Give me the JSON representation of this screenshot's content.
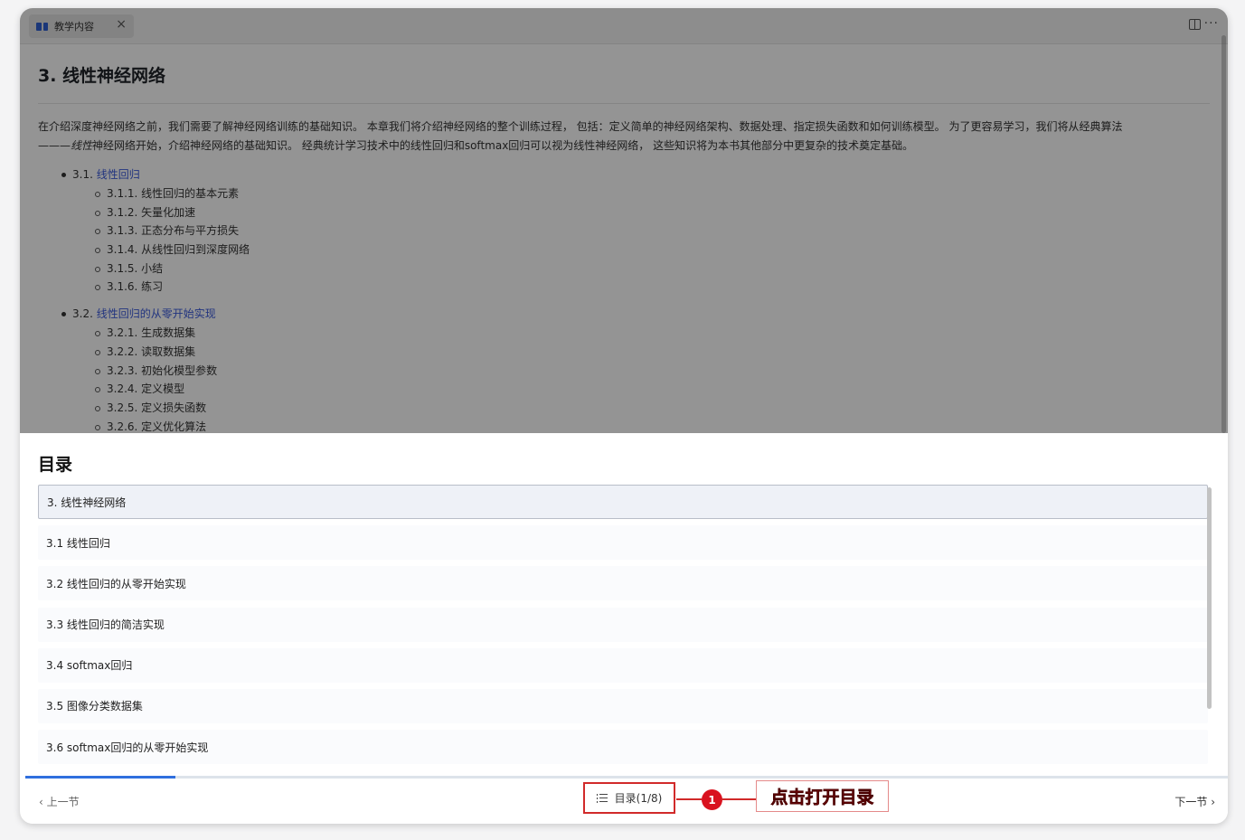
{
  "tab": {
    "title": "教学内容",
    "close": "×"
  },
  "content": {
    "title": "3. 线性神经网络",
    "intro_1": "在介绍深度神经网络之前，我们需要了解神经网络训练的基础知识。 本章我们将介绍神经网络的整个训练过程， 包括：定义简单的神经网络架构、数据处理、指定损失函数和如何训练模型。 为了更容易学习，我们将从经典算法",
    "intro_2a": "———",
    "intro_2b": "线性",
    "intro_2c": "神经网络开始，介绍神经网络的基础知识。 经典统计学习技术中的线性回归和softmax回归可以视为线性神经网络， 这些知识将为本书其他部分中更复杂的技术奠定基础。",
    "sections": [
      {
        "num": "3.1.",
        "link": "线性回归",
        "subs": [
          "3.1.1. 线性回归的基本元素",
          "3.1.2. 矢量化加速",
          "3.1.3. 正态分布与平方损失",
          "3.1.4. 从线性回归到深度网络",
          "3.1.5. 小结",
          "3.1.6. 练习"
        ]
      },
      {
        "num": "3.2.",
        "link": "线性回归的从零开始实现",
        "subs": [
          "3.2.1. 生成数据集",
          "3.2.2. 读取数据集",
          "3.2.3. 初始化模型参数",
          "3.2.4. 定义模型",
          "3.2.5. 定义损失函数",
          "3.2.6. 定义优化算法"
        ]
      }
    ]
  },
  "sheet": {
    "title": "目录",
    "items": [
      "3. 线性神经网络",
      "3.1 线性回归",
      "3.2 线性回归的从零开始实现",
      "3.3 线性回归的简洁实现",
      "3.4 softmax回归",
      "3.5 图像分类数据集",
      "3.6 softmax回归的从零开始实现"
    ],
    "active_index": 0
  },
  "footer": {
    "prev": "上一节",
    "next": "下一节",
    "toc_button": "目录(1/8)",
    "progress": 0.125
  },
  "annotation": {
    "number": "1",
    "label": "点击打开目录"
  },
  "colors": {
    "accent": "#2f6fde",
    "annotation": "#d12a2a",
    "link": "#3b5bdb"
  }
}
